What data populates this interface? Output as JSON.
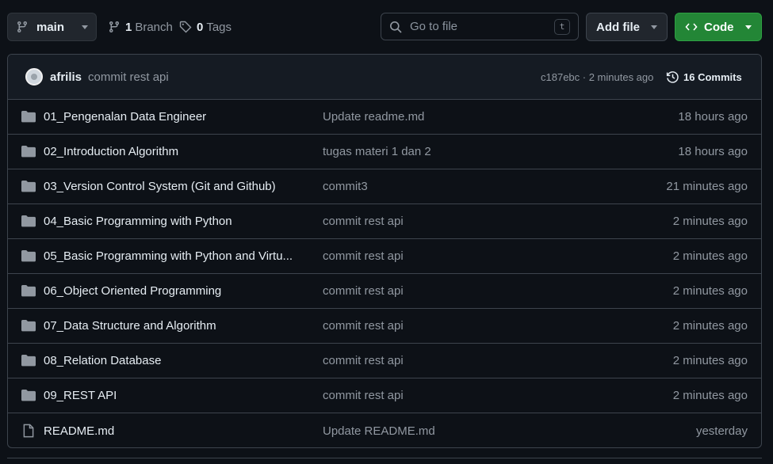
{
  "toolbar": {
    "branch": "main",
    "branches_count": "1",
    "branches_label": "Branch",
    "tags_count": "0",
    "tags_label": "Tags",
    "search_placeholder": "Go to file",
    "search_shortcut": "t",
    "add_file": "Add file",
    "code": "Code"
  },
  "commit": {
    "author": "afrilis",
    "message": "commit rest api",
    "hash_time": "c187ebc · 2 minutes ago",
    "commits_label": "16 Commits"
  },
  "files": [
    {
      "name": "01_Pengenalan Data Engineer",
      "type": "folder",
      "message": "Update readme.md",
      "time": "18 hours ago"
    },
    {
      "name": "02_Introduction Algorithm",
      "type": "folder",
      "message": "tugas materi 1 dan 2",
      "time": "18 hours ago"
    },
    {
      "name": "03_Version Control System (Git and Github)",
      "type": "folder",
      "message": "commit3",
      "time": "21 minutes ago"
    },
    {
      "name": "04_Basic Programming with Python",
      "type": "folder",
      "message": "commit rest api",
      "time": "2 minutes ago"
    },
    {
      "name": "05_Basic Programming with Python and Virtu...",
      "type": "folder",
      "message": "commit rest api",
      "time": "2 minutes ago"
    },
    {
      "name": "06_Object Oriented Programming",
      "type": "folder",
      "message": "commit rest api",
      "time": "2 minutes ago"
    },
    {
      "name": "07_Data Structure and Algorithm",
      "type": "folder",
      "message": "commit rest api",
      "time": "2 minutes ago"
    },
    {
      "name": "08_Relation Database",
      "type": "folder",
      "message": "commit rest api",
      "time": "2 minutes ago"
    },
    {
      "name": "09_REST API",
      "type": "folder",
      "message": "commit rest api",
      "time": "2 minutes ago"
    },
    {
      "name": "README.md",
      "type": "file",
      "message": "Update README.md",
      "time": "yesterday"
    }
  ],
  "colors": {
    "background": "#0d1117",
    "code_button": "#238636",
    "muted_text": "#9198a1",
    "border": "#3d444d"
  }
}
